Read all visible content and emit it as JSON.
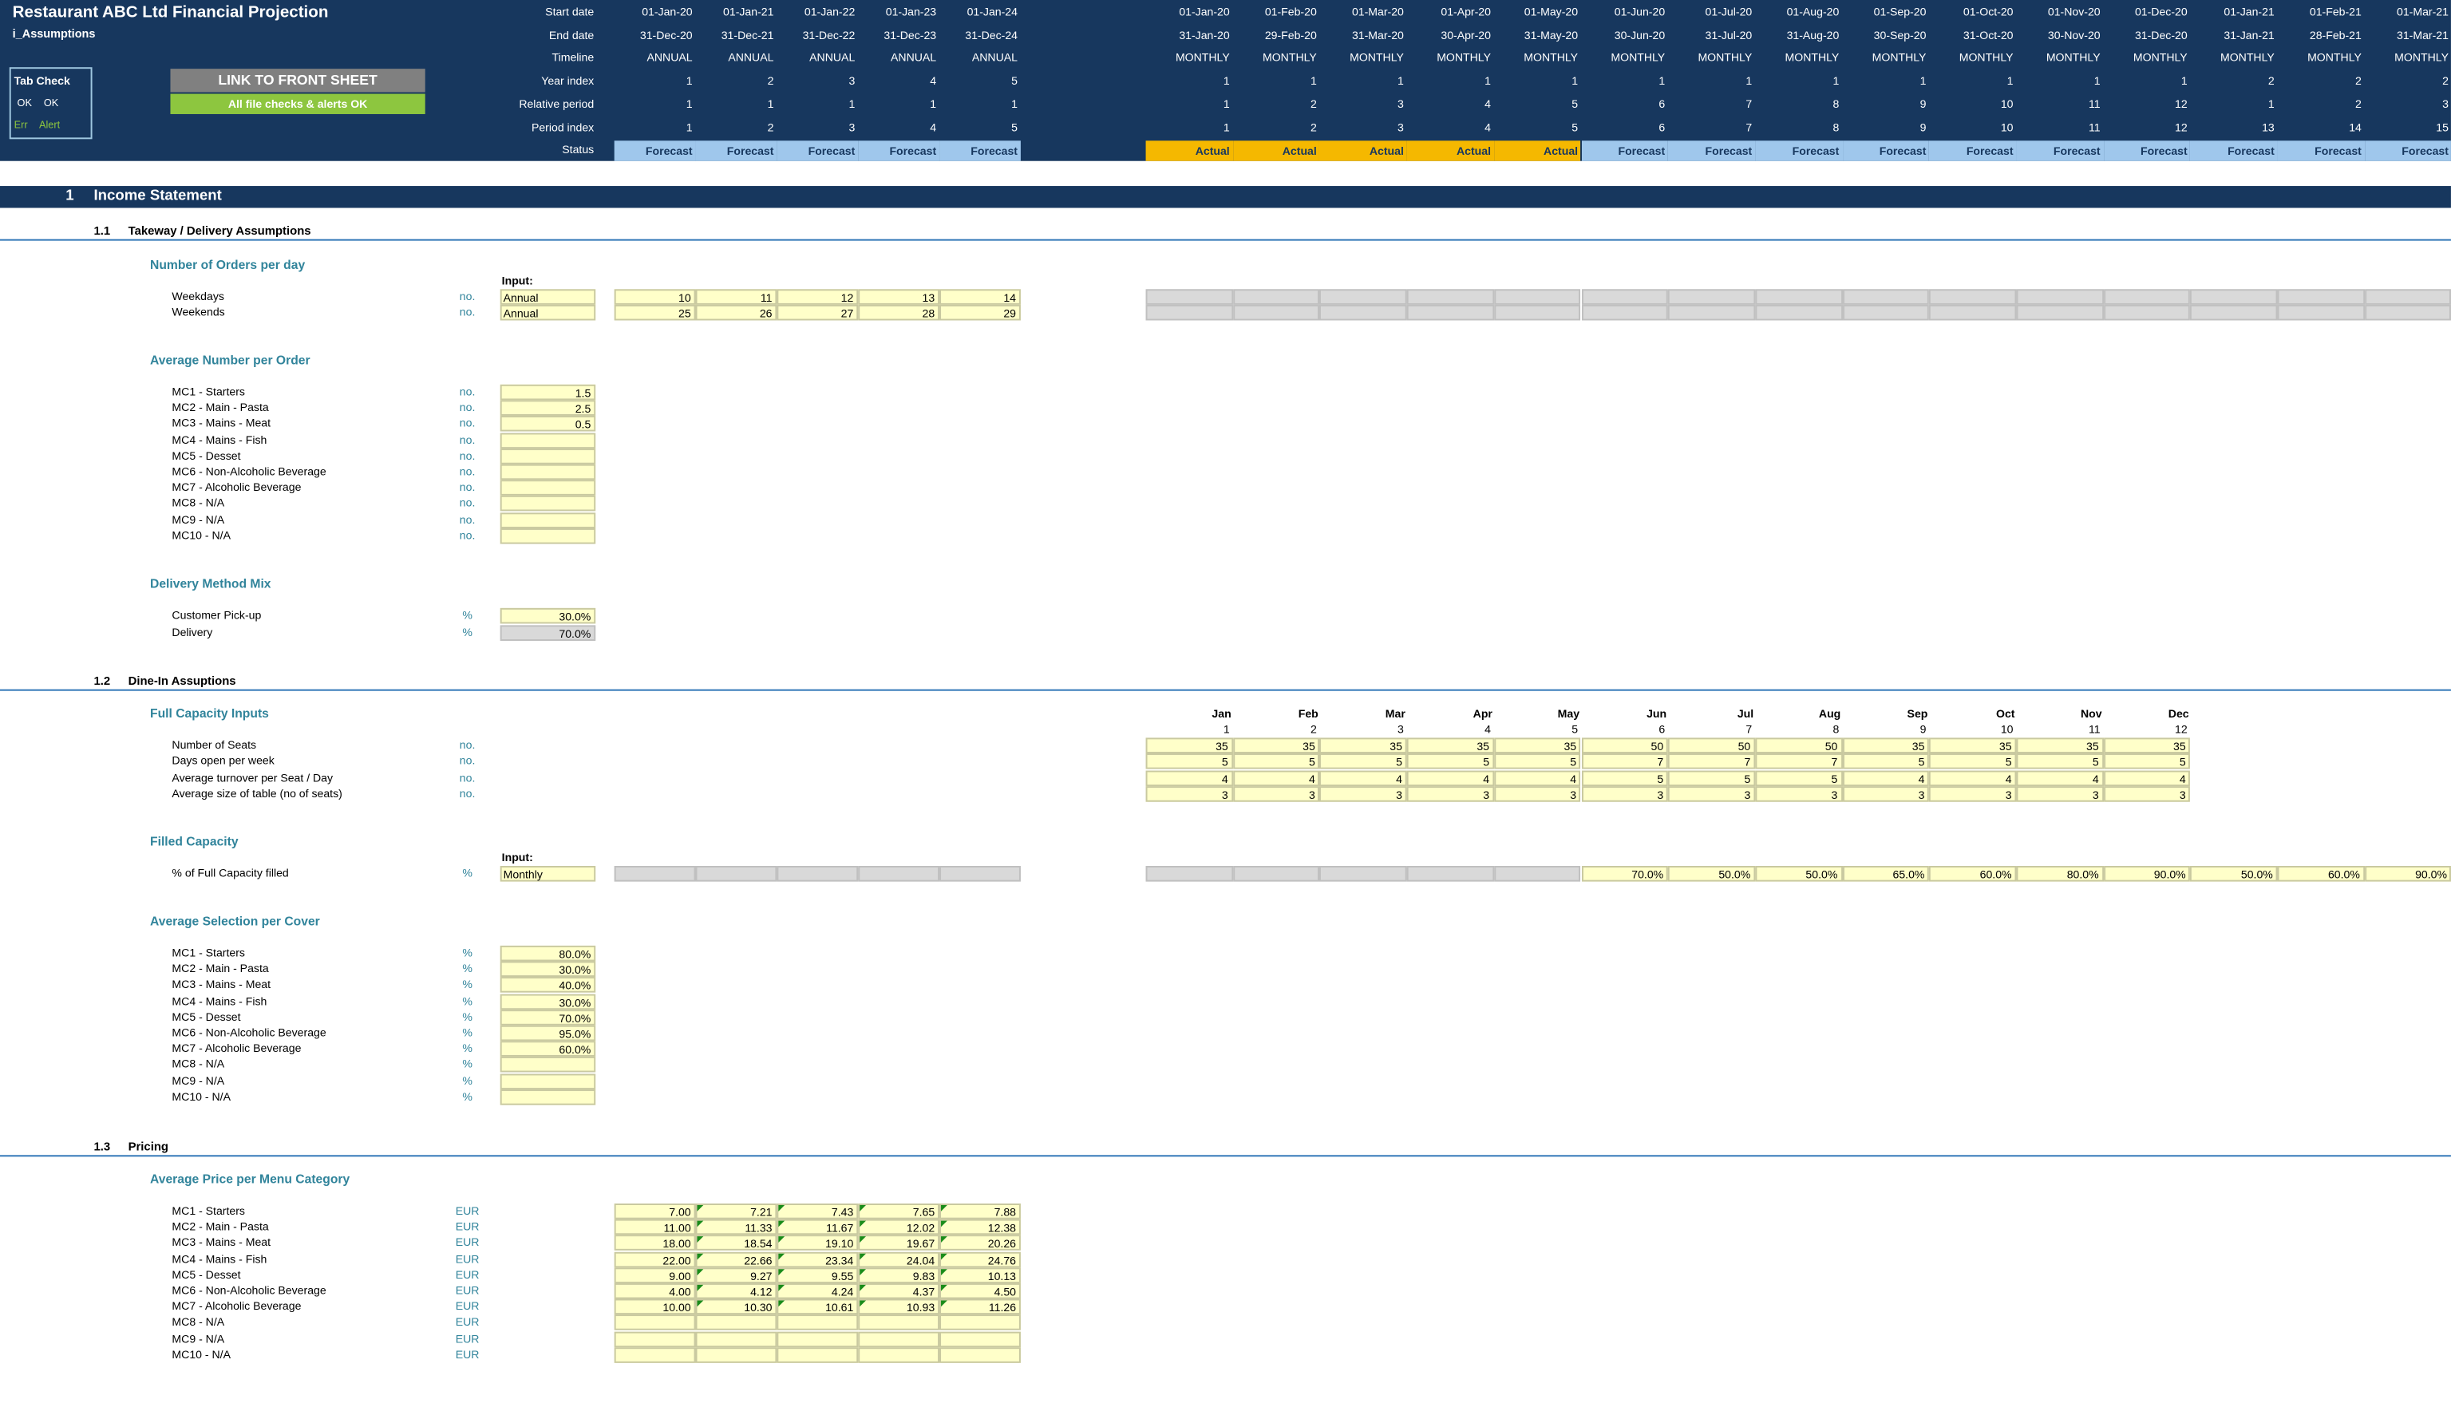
{
  "header": {
    "title": "Restaurant ABC Ltd Financial Projection",
    "sheet": "i_Assumptions",
    "row_labels": [
      "Start date",
      "End date",
      "Timeline",
      "Year index",
      "Relative period",
      "Period index",
      "Status"
    ],
    "tab_check": {
      "title": "Tab Check",
      "ok1": "OK",
      "ok2": "OK",
      "err": "Err",
      "alert": "Alert"
    },
    "link_button": "LINK TO FRONT SHEET",
    "checks_ok": "All file checks & alerts OK"
  },
  "annual_cols": [
    {
      "start": "01-Jan-20",
      "end": "31-Dec-20",
      "timeline": "ANNUAL",
      "year": "1",
      "rel": "1",
      "idx": "1",
      "status": "Forecast"
    },
    {
      "start": "01-Jan-21",
      "end": "31-Dec-21",
      "timeline": "ANNUAL",
      "year": "2",
      "rel": "1",
      "idx": "2",
      "status": "Forecast"
    },
    {
      "start": "01-Jan-22",
      "end": "31-Dec-22",
      "timeline": "ANNUAL",
      "year": "3",
      "rel": "1",
      "idx": "3",
      "status": "Forecast"
    },
    {
      "start": "01-Jan-23",
      "end": "31-Dec-23",
      "timeline": "ANNUAL",
      "year": "4",
      "rel": "1",
      "idx": "4",
      "status": "Forecast"
    },
    {
      "start": "01-Jan-24",
      "end": "31-Dec-24",
      "timeline": "ANNUAL",
      "year": "5",
      "rel": "1",
      "idx": "5",
      "status": "Forecast"
    }
  ],
  "monthly_cols": [
    {
      "start": "01-Jan-20",
      "end": "31-Jan-20",
      "timeline": "MONTHLY",
      "year": "1",
      "rel": "1",
      "idx": "1",
      "status": "Actual"
    },
    {
      "start": "01-Feb-20",
      "end": "29-Feb-20",
      "timeline": "MONTHLY",
      "year": "1",
      "rel": "2",
      "idx": "2",
      "status": "Actual"
    },
    {
      "start": "01-Mar-20",
      "end": "31-Mar-20",
      "timeline": "MONTHLY",
      "year": "1",
      "rel": "3",
      "idx": "3",
      "status": "Actual"
    },
    {
      "start": "01-Apr-20",
      "end": "30-Apr-20",
      "timeline": "MONTHLY",
      "year": "1",
      "rel": "4",
      "idx": "4",
      "status": "Actual"
    },
    {
      "start": "01-May-20",
      "end": "31-May-20",
      "timeline": "MONTHLY",
      "year": "1",
      "rel": "5",
      "idx": "5",
      "status": "Actual"
    },
    {
      "start": "01-Jun-20",
      "end": "30-Jun-20",
      "timeline": "MONTHLY",
      "year": "1",
      "rel": "6",
      "idx": "6",
      "status": "Forecast"
    },
    {
      "start": "01-Jul-20",
      "end": "31-Jul-20",
      "timeline": "MONTHLY",
      "year": "1",
      "rel": "7",
      "idx": "7",
      "status": "Forecast"
    },
    {
      "start": "01-Aug-20",
      "end": "31-Aug-20",
      "timeline": "MONTHLY",
      "year": "1",
      "rel": "8",
      "idx": "8",
      "status": "Forecast"
    },
    {
      "start": "01-Sep-20",
      "end": "30-Sep-20",
      "timeline": "MONTHLY",
      "year": "1",
      "rel": "9",
      "idx": "9",
      "status": "Forecast"
    },
    {
      "start": "01-Oct-20",
      "end": "31-Oct-20",
      "timeline": "MONTHLY",
      "year": "1",
      "rel": "10",
      "idx": "10",
      "status": "Forecast"
    },
    {
      "start": "01-Nov-20",
      "end": "30-Nov-20",
      "timeline": "MONTHLY",
      "year": "1",
      "rel": "11",
      "idx": "11",
      "status": "Forecast"
    },
    {
      "start": "01-Dec-20",
      "end": "31-Dec-20",
      "timeline": "MONTHLY",
      "year": "1",
      "rel": "12",
      "idx": "12",
      "status": "Forecast"
    },
    {
      "start": "01-Jan-21",
      "end": "31-Jan-21",
      "timeline": "MONTHLY",
      "year": "2",
      "rel": "1",
      "idx": "13",
      "status": "Forecast"
    },
    {
      "start": "01-Feb-21",
      "end": "28-Feb-21",
      "timeline": "MONTHLY",
      "year": "2",
      "rel": "2",
      "idx": "14",
      "status": "Forecast"
    },
    {
      "start": "01-Mar-21",
      "end": "31-Mar-21",
      "timeline": "MONTHLY",
      "year": "2",
      "rel": "3",
      "idx": "15",
      "status": "Forecast"
    }
  ],
  "section": {
    "num": "1",
    "title": "Income Statement"
  },
  "s11": {
    "num": "1.1",
    "title": "Takeway / Delivery Assumptions",
    "orders": {
      "title": "Number of Orders per day",
      "input_label": "Input:",
      "rows": [
        {
          "label": "Weekdays",
          "unit": "no.",
          "input": "Annual",
          "values": [
            "10",
            "11",
            "12",
            "13",
            "14"
          ]
        },
        {
          "label": "Weekends",
          "unit": "no.",
          "input": "Annual",
          "values": [
            "25",
            "26",
            "27",
            "28",
            "29"
          ]
        }
      ]
    },
    "avg": {
      "title": "Average Number per Order",
      "rows": [
        {
          "label": "MC1 - Starters",
          "unit": "no.",
          "value": "1.5"
        },
        {
          "label": "MC2 - Main - Pasta",
          "unit": "no.",
          "value": "2.5"
        },
        {
          "label": "MC3 - Mains - Meat",
          "unit": "no.",
          "value": "0.5"
        },
        {
          "label": "MC4 - Mains - Fish",
          "unit": "no.",
          "value": ""
        },
        {
          "label": "MC5 - Desset",
          "unit": "no.",
          "value": ""
        },
        {
          "label": "MC6 - Non-Alcoholic Beverage",
          "unit": "no.",
          "value": ""
        },
        {
          "label": "MC7 - Alcoholic Beverage",
          "unit": "no.",
          "value": ""
        },
        {
          "label": "MC8 - N/A",
          "unit": "no.",
          "value": ""
        },
        {
          "label": "MC9 - N/A",
          "unit": "no.",
          "value": ""
        },
        {
          "label": "MC10 - N/A",
          "unit": "no.",
          "value": ""
        }
      ]
    },
    "mix": {
      "title": "Delivery Method Mix",
      "rows": [
        {
          "label": "Customer Pick-up",
          "unit": "%",
          "value": "30.0%"
        },
        {
          "label": "Delivery",
          "unit": "%",
          "value": "70.0%"
        }
      ]
    }
  },
  "s12": {
    "num": "1.2",
    "title": "Dine-In Assuptions",
    "full": {
      "title": "Full Capacity Inputs",
      "months": [
        "Jan",
        "Feb",
        "Mar",
        "Apr",
        "May",
        "Jun",
        "Jul",
        "Aug",
        "Sep",
        "Oct",
        "Nov",
        "Dec"
      ],
      "month_nums": [
        "1",
        "2",
        "3",
        "4",
        "5",
        "6",
        "7",
        "8",
        "9",
        "10",
        "11",
        "12"
      ],
      "rows": [
        {
          "label": "Number of Seats",
          "unit": "no.",
          "values": [
            "35",
            "35",
            "35",
            "35",
            "35",
            "50",
            "50",
            "50",
            "35",
            "35",
            "35",
            "35"
          ]
        },
        {
          "label": "Days open per week",
          "unit": "no.",
          "values": [
            "5",
            "5",
            "5",
            "5",
            "5",
            "7",
            "7",
            "7",
            "5",
            "5",
            "5",
            "5"
          ]
        },
        {
          "label": "Average turnover per Seat / Day",
          "unit": "no.",
          "values": [
            "4",
            "4",
            "4",
            "4",
            "4",
            "5",
            "5",
            "5",
            "4",
            "4",
            "4",
            "4"
          ]
        },
        {
          "label": "Average size of table (no of seats)",
          "unit": "no.",
          "values": [
            "3",
            "3",
            "3",
            "3",
            "3",
            "3",
            "3",
            "3",
            "3",
            "3",
            "3",
            "3"
          ]
        }
      ]
    },
    "filled": {
      "title": "Filled Capacity",
      "input_label": "Input:",
      "label": "% of Full Capacity filled",
      "unit": "%",
      "input": "Monthly",
      "values": [
        "70.0%",
        "50.0%",
        "50.0%",
        "65.0%",
        "60.0%",
        "80.0%",
        "90.0%",
        "50.0%",
        "60.0%",
        "90.0%"
      ]
    },
    "sel": {
      "title": "Average Selection per Cover",
      "rows": [
        {
          "label": "MC1 - Starters",
          "unit": "%",
          "value": "80.0%"
        },
        {
          "label": "MC2 - Main - Pasta",
          "unit": "%",
          "value": "30.0%"
        },
        {
          "label": "MC3 - Mains - Meat",
          "unit": "%",
          "value": "40.0%"
        },
        {
          "label": "MC4 - Mains - Fish",
          "unit": "%",
          "value": "30.0%"
        },
        {
          "label": "MC5 - Desset",
          "unit": "%",
          "value": "70.0%"
        },
        {
          "label": "MC6 - Non-Alcoholic Beverage",
          "unit": "%",
          "value": "95.0%"
        },
        {
          "label": "MC7 - Alcoholic Beverage",
          "unit": "%",
          "value": "60.0%"
        },
        {
          "label": "MC8 - N/A",
          "unit": "%",
          "value": ""
        },
        {
          "label": "MC9 - N/A",
          "unit": "%",
          "value": ""
        },
        {
          "label": "MC10 - N/A",
          "unit": "%",
          "value": ""
        }
      ]
    }
  },
  "s13": {
    "num": "1.3",
    "title": "Pricing",
    "price": {
      "title": "Average Price per Menu Category",
      "rows": [
        {
          "label": "MC1 - Starters",
          "unit": "EUR",
          "values": [
            "7.00",
            "7.21",
            "7.43",
            "7.65",
            "7.88"
          ]
        },
        {
          "label": "MC2 - Main - Pasta",
          "unit": "EUR",
          "values": [
            "11.00",
            "11.33",
            "11.67",
            "12.02",
            "12.38"
          ]
        },
        {
          "label": "MC3 - Mains - Meat",
          "unit": "EUR",
          "values": [
            "18.00",
            "18.54",
            "19.10",
            "19.67",
            "20.26"
          ]
        },
        {
          "label": "MC4 - Mains - Fish",
          "unit": "EUR",
          "values": [
            "22.00",
            "22.66",
            "23.34",
            "24.04",
            "24.76"
          ]
        },
        {
          "label": "MC5 - Desset",
          "unit": "EUR",
          "values": [
            "9.00",
            "9.27",
            "9.55",
            "9.83",
            "10.13"
          ]
        },
        {
          "label": "MC6 - Non-Alcoholic Beverage",
          "unit": "EUR",
          "values": [
            "4.00",
            "4.12",
            "4.24",
            "4.37",
            "4.50"
          ]
        },
        {
          "label": "MC7 - Alcoholic Beverage",
          "unit": "EUR",
          "values": [
            "10.00",
            "10.30",
            "10.61",
            "10.93",
            "11.26"
          ]
        },
        {
          "label": "MC8 - N/A",
          "unit": "EUR",
          "values": [
            "",
            "",
            "",
            "",
            ""
          ]
        },
        {
          "label": "MC9 - N/A",
          "unit": "EUR",
          "values": [
            "",
            "",
            "",
            "",
            ""
          ]
        },
        {
          "label": "MC10 - N/A",
          "unit": "EUR",
          "values": [
            "",
            "",
            "",
            "",
            ""
          ]
        }
      ]
    }
  }
}
